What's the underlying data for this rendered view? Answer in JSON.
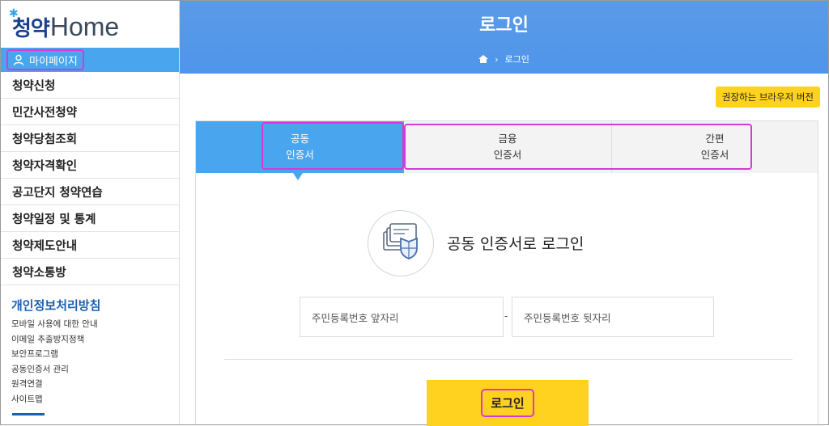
{
  "logo": {
    "korean": "청약",
    "english": "Home"
  },
  "sidebar": {
    "mypage_label": "마이페이지",
    "menu": [
      "청약신청",
      "민간사전청약",
      "청약당첨조회",
      "청약자격확인",
      "공고단지 청약연습",
      "청약일정 및 통계",
      "청약제도안내",
      "청약소통방"
    ],
    "privacy_title": "개인정보처리방침",
    "links": [
      "모바일 사용에 대한 안내",
      "이메일 추출방지정책",
      "보안프로그램",
      "공동인증서 관리",
      "원격연결",
      "사이트맵"
    ]
  },
  "header": {
    "title": "로그인",
    "breadcrumb": "로그인"
  },
  "browser_button": "권장하는 브라우저 버전",
  "tabs": [
    {
      "line1": "공동",
      "line2": "인증서"
    },
    {
      "line1": "금융",
      "line2": "인증서"
    },
    {
      "line1": "간편",
      "line2": "인증서"
    }
  ],
  "login_heading": "공동 인증서로 로그인",
  "fields": {
    "front_placeholder": "주민등록번호 앞자리",
    "separator": "-",
    "back_placeholder": "주민등록번호 뒷자리"
  },
  "login_button": "로그인",
  "colors": {
    "accent_blue": "#49a6ee",
    "header_blue": "#5a9be8",
    "button_yellow": "#ffd21f",
    "highlight_magenta": "#d63ad6",
    "link_blue": "#1d5fb0"
  }
}
